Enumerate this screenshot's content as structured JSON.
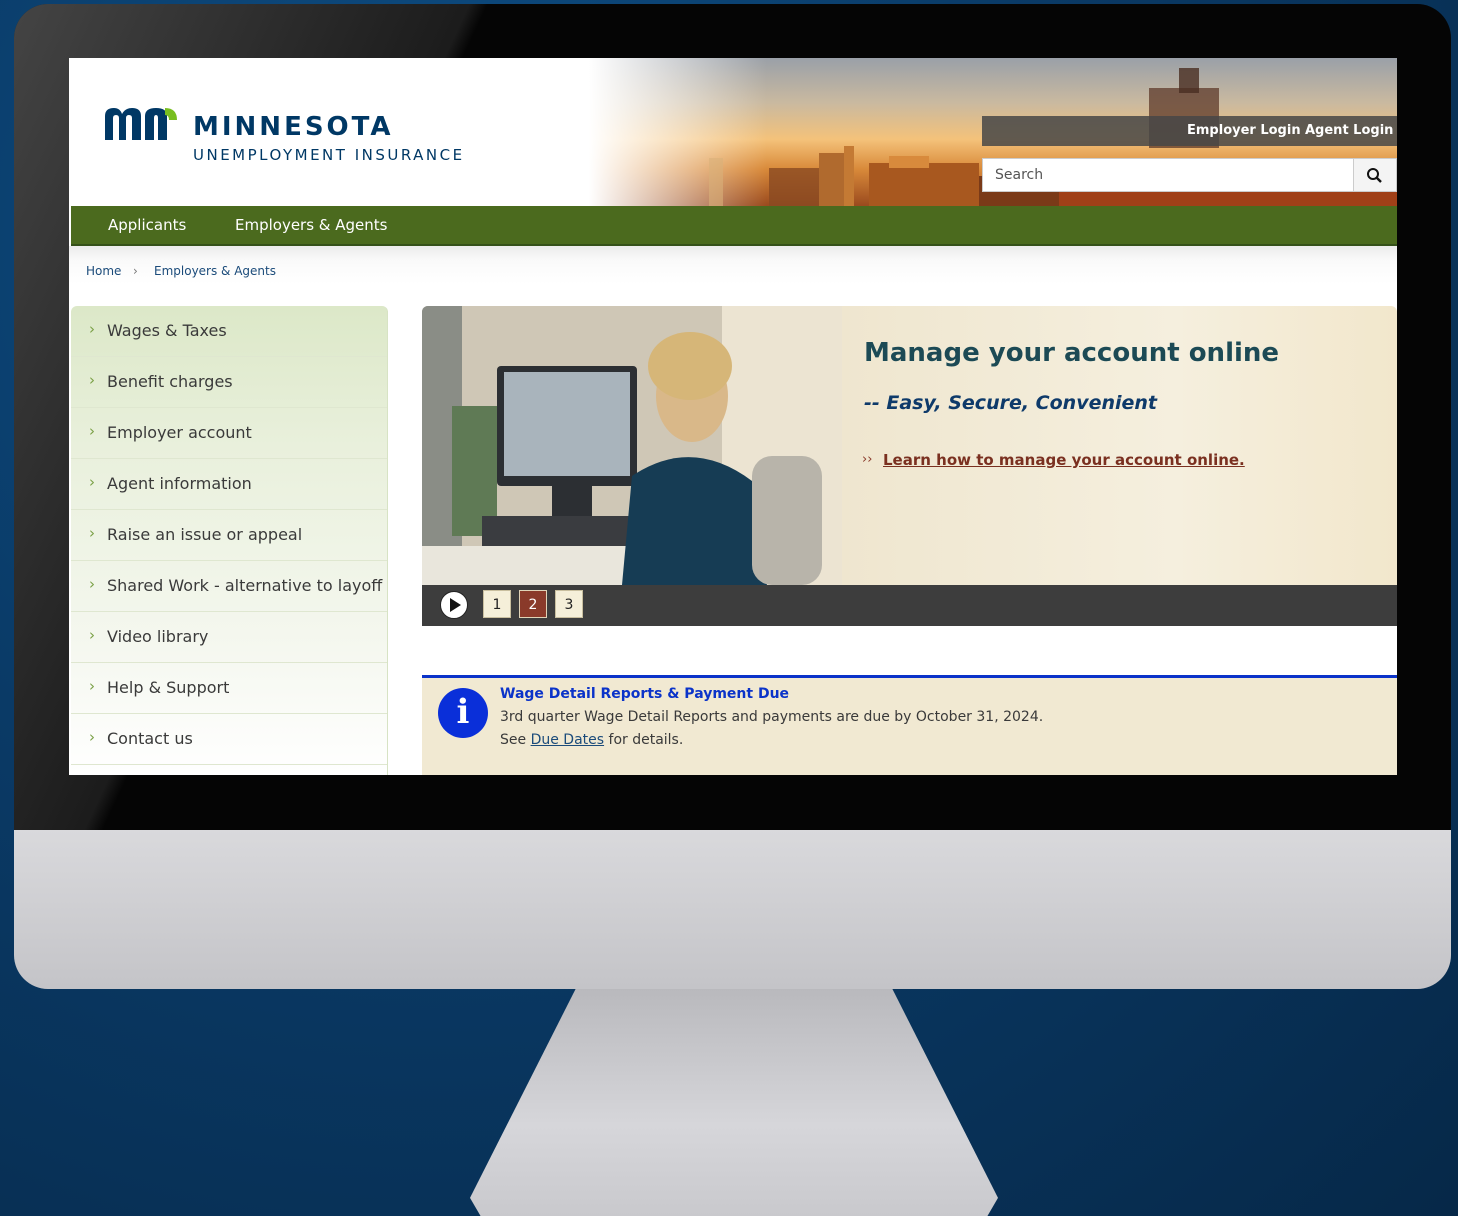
{
  "site": {
    "logo_title": "MINNESOTA",
    "logo_subtitle": "UNEMPLOYMENT INSURANCE",
    "logo_mark_text": "mn",
    "brand_color": "#003865"
  },
  "header": {
    "employer_login": "Employer Login",
    "agent_login": "Agent Login",
    "search_placeholder": "Search",
    "search_icon": "search-icon"
  },
  "nav": {
    "items": [
      {
        "label": "Applicants"
      },
      {
        "label": "Employers & Agents"
      }
    ],
    "color": "#4b6a1e"
  },
  "breadcrumb": {
    "home": "Home",
    "separator": "›",
    "current": "Employers & Agents"
  },
  "sidebar": {
    "chevron": "›",
    "items": [
      {
        "label": "Wages & Taxes"
      },
      {
        "label": "Benefit charges"
      },
      {
        "label": "Employer account"
      },
      {
        "label": "Agent information"
      },
      {
        "label": "Raise an issue or appeal"
      },
      {
        "label": "Shared Work - alternative to layoff"
      },
      {
        "label": "Video library"
      },
      {
        "label": "Help & Support"
      },
      {
        "label": "Contact us"
      }
    ]
  },
  "hero": {
    "title": "Manage your account online",
    "subtitle": "-- Easy, Secure, Convenient",
    "link_arrows": "››",
    "link_text": "Learn how to manage your account online.",
    "slides": [
      "1",
      "2",
      "3"
    ],
    "active_slide": "2",
    "play_icon": "play-icon"
  },
  "alert": {
    "icon": "info-icon",
    "icon_glyph": "i",
    "title": "Wage Detail Reports & Payment Due",
    "line1": "3rd quarter Wage Detail Reports and payments are due by October 31, 2024.",
    "line2_prefix": "See ",
    "line2_link": "Due Dates",
    "line2_suffix": " for details.",
    "accent": "#0b33c9"
  }
}
